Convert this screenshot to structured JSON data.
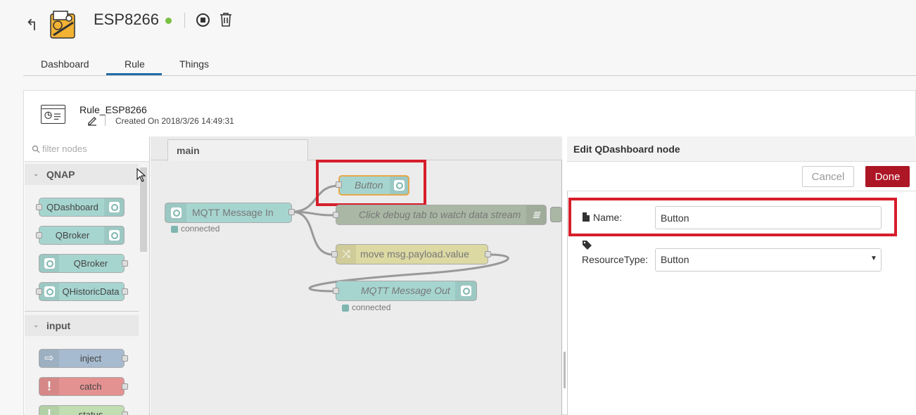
{
  "header": {
    "title": "ESP8266",
    "status_color": "#7ac142"
  },
  "tabs": [
    {
      "label": "Dashboard"
    },
    {
      "label": "Rule",
      "active": true
    },
    {
      "label": "Things"
    }
  ],
  "rule": {
    "name": "Rule_ESP8266",
    "created": "Created On 2018/3/26 14:49:31"
  },
  "palette": {
    "filter_placeholder": "filter nodes",
    "categories": [
      {
        "label": "QNAP",
        "nodes": [
          "QDashboard",
          "QBroker",
          "QBroker",
          "QHistoricData"
        ]
      },
      {
        "label": "input",
        "nodes": [
          "inject",
          "catch",
          "status"
        ]
      }
    ]
  },
  "workspace": {
    "tab_label": "main",
    "nodes": {
      "mqtt_in": "MQTT Message In",
      "mqtt_in_status": "connected",
      "button": "Button",
      "debug": "Click debug tab to watch data stream",
      "change": "move msg.payload.value",
      "mqtt_out": "MQTT Message Out",
      "mqtt_out_status": "connected"
    }
  },
  "edit_panel": {
    "title": "Edit QDashboard node",
    "cancel_label": "Cancel",
    "done_label": "Done",
    "name_label": "Name:",
    "name_value": "Button",
    "resource_type_label": "ResourceType:",
    "resource_type_value": "Button"
  },
  "colors": {
    "highlight": "#d61e2b",
    "done_button": "#ad1625",
    "accent_tab": "#1e6ca8"
  }
}
